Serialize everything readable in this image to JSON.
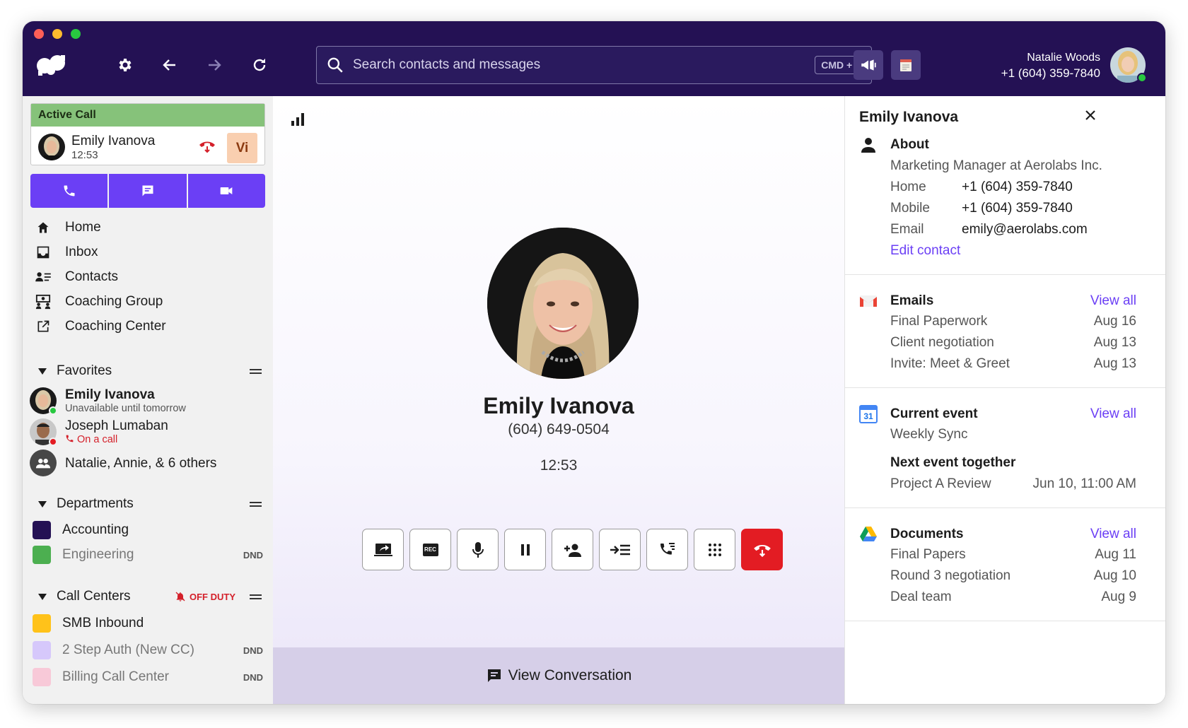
{
  "header": {
    "search": {
      "placeholder": "Search contacts and messages",
      "shortcut": "CMD + /"
    },
    "user": {
      "name": "Natalie Woods",
      "phone": "+1 (604) 359-7840"
    }
  },
  "active_call": {
    "label": "Active Call",
    "name": "Emily Ivanova",
    "duration": "12:53",
    "initials": "Vi"
  },
  "nav": [
    {
      "label": "Home",
      "icon": "home-icon"
    },
    {
      "label": "Inbox",
      "icon": "inbox-icon"
    },
    {
      "label": "Contacts",
      "icon": "contacts-icon"
    },
    {
      "label": "Coaching Group",
      "icon": "coaching-group-icon"
    },
    {
      "label": "Coaching Center",
      "icon": "external-link-icon"
    }
  ],
  "favorites": {
    "title": "Favorites",
    "items": [
      {
        "name": "Emily Ivanova",
        "status": "Unavailable until tomorrow"
      },
      {
        "name": "Joseph Lumaban",
        "status": "On a call"
      },
      {
        "name": "Natalie, Annie, & 6 others"
      }
    ]
  },
  "departments": {
    "title": "Departments",
    "items": [
      {
        "name": "Accounting",
        "badge": "",
        "color": "#241154"
      },
      {
        "name": "Engineering",
        "badge": "DND",
        "color": "#4caf50"
      }
    ]
  },
  "call_centers": {
    "title": "Call Centers",
    "status": "OFF DUTY",
    "items": [
      {
        "name": "SMB Inbound",
        "badge": "",
        "color": "#ffc21a"
      },
      {
        "name": "2 Step Auth (New CC)",
        "badge": "DND",
        "color": "#d6c8fb"
      },
      {
        "name": "Billing Call Center",
        "badge": "DND",
        "color": "#f8c9d8"
      }
    ]
  },
  "call": {
    "name": "Emily Ivanova",
    "phone": "(604) 649-0504",
    "timer": "12:53",
    "record_label": "REC",
    "view_conversation": "View Conversation"
  },
  "panel": {
    "title": "Emily Ivanova",
    "about": {
      "title": "About",
      "role": "Marketing Manager at Aerolabs Inc.",
      "fields": [
        {
          "label": "Home",
          "value": "+1 (604) 359-7840"
        },
        {
          "label": "Mobile",
          "value": "+1 (604) 359-7840"
        },
        {
          "label": "Email",
          "value": "emily@aerolabs.com"
        }
      ],
      "edit": "Edit contact"
    },
    "emails": {
      "title": "Emails",
      "view_all": "View all",
      "items": [
        {
          "subject": "Final Paperwork",
          "date": "Aug 16"
        },
        {
          "subject": "Client negotiation",
          "date": "Aug 13"
        },
        {
          "subject": "Invite: Meet & Greet",
          "date": "Aug 13"
        }
      ]
    },
    "current_event": {
      "title": "Current event",
      "view_all": "View all",
      "calendar_day": "31",
      "name": "Weekly Sync",
      "next_title": "Next event together",
      "next_name": "Project A Review",
      "next_time": "Jun 10, 11:00 AM"
    },
    "documents": {
      "title": "Documents",
      "view_all": "View all",
      "items": [
        {
          "name": "Final Papers",
          "date": "Aug 11"
        },
        {
          "name": "Round 3 negotiation",
          "date": "Aug 10"
        },
        {
          "name": "Deal team",
          "date": "Aug 9"
        }
      ]
    }
  },
  "colors": {
    "brand_dark": "#241154",
    "accent": "#6b3ff5",
    "danger": "#e31c23",
    "active_green": "#86c27a"
  }
}
